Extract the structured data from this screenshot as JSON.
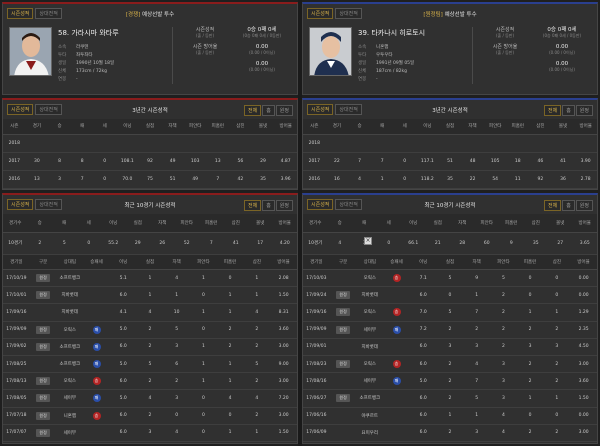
{
  "tabs": {
    "season": "시즌성적",
    "vs": "상대전적"
  },
  "left": {
    "header_team": "[경쟁]",
    "header_title": "예상선발 투수",
    "name": "58. 가라시마 와타루",
    "info": [
      {
        "k": "소속",
        "v": "라쿠텐"
      },
      {
        "k": "투타",
        "v": "좌투좌타"
      },
      {
        "k": "생일",
        "v": "1990년 10월 18일"
      },
      {
        "k": "신체",
        "v": "173cm / 72kg"
      },
      {
        "k": "연봉",
        "v": "-"
      }
    ],
    "stats": [
      {
        "k": "시즌성적",
        "ks": "(출 / 등판)",
        "v": "0승 0패 0세",
        "vs": "(0승 0패 0세 / 0등판)"
      },
      {
        "k": "시즌 방어율",
        "ks": "(출 / 등판)",
        "v": "0.00",
        "vs": "(0.00 / 0이닝)"
      },
      {
        "k": "",
        "ks": "",
        "v": "0.00",
        "vs": "(0.00 / 0이닝)"
      }
    ],
    "three_title": "3년간 시즌성적",
    "three_rows": [
      [
        "2018",
        "",
        "",
        "",
        "",
        "",
        "",
        "",
        "",
        "",
        "",
        "",
        ""
      ],
      [
        "2017",
        "30",
        "8",
        "8",
        "0",
        "108.1",
        "92",
        "49",
        "103",
        "13",
        "56",
        "29",
        "4.87"
      ],
      [
        "2016",
        "13",
        "3",
        "7",
        "0",
        "70.0",
        "75",
        "51",
        "49",
        "7",
        "42",
        "35",
        "3.96"
      ]
    ],
    "recent_title": "최근 10경기 시즌성적",
    "sum_row": [
      "10경기",
      "2",
      "5",
      "0",
      "55.2",
      "29",
      "26",
      "52",
      "7",
      "41",
      "17",
      "4.20"
    ],
    "games": [
      {
        "date": "17/10/19",
        "kind": "원정",
        "opp": "소프트뱅크",
        "res": "",
        "ip": "5.1",
        "r": "1",
        "h": "4",
        "bb": "1",
        "so": "0",
        "er": "1",
        "era": "2.08"
      },
      {
        "date": "17/10/01",
        "kind": "원정",
        "opp": "지바롯데",
        "res": "",
        "ip": "6.0",
        "r": "1",
        "h": "1",
        "bb": "0",
        "so": "1",
        "er": "1",
        "era": "1.50"
      },
      {
        "date": "17/09/16",
        "kind": "",
        "opp": "지바롯데",
        "res": "",
        "ip": "4.1",
        "r": "4",
        "h": "10",
        "bb": "1",
        "so": "1",
        "er": "4",
        "era": "8.31"
      },
      {
        "date": "17/09/09",
        "kind": "원정",
        "opp": "오릭스",
        "res": "loss",
        "ip": "5.0",
        "r": "2",
        "h": "5",
        "bb": "0",
        "so": "2",
        "er": "2",
        "era": "3.60"
      },
      {
        "date": "17/09/02",
        "kind": "원정",
        "opp": "소프트뱅크",
        "res": "loss",
        "ip": "6.0",
        "r": "2",
        "h": "3",
        "bb": "1",
        "so": "2",
        "er": "2",
        "era": "3.00"
      },
      {
        "date": "17/08/25",
        "kind": "",
        "opp": "소프트뱅크",
        "res": "loss",
        "ip": "5.0",
        "r": "5",
        "h": "6",
        "bb": "1",
        "so": "1",
        "er": "5",
        "era": "9.00"
      },
      {
        "date": "17/08/13",
        "kind": "원정",
        "opp": "오릭스",
        "res": "win",
        "ip": "6.0",
        "r": "2",
        "h": "2",
        "bb": "1",
        "so": "1",
        "er": "2",
        "era": "3.00"
      },
      {
        "date": "17/08/05",
        "kind": "원정",
        "opp": "세이부",
        "res": "loss",
        "ip": "5.0",
        "r": "4",
        "h": "3",
        "bb": "0",
        "so": "4",
        "er": "4",
        "era": "7.20"
      },
      {
        "date": "17/07/18",
        "kind": "원정",
        "opp": "니혼햄",
        "res": "win",
        "ip": "6.0",
        "r": "2",
        "h": "0",
        "bb": "0",
        "so": "0",
        "er": "2",
        "era": "3.00"
      },
      {
        "date": "17/07/07",
        "kind": "원정",
        "opp": "세이부",
        "res": "",
        "ip": "6.0",
        "r": "3",
        "h": "4",
        "bb": "0",
        "so": "1",
        "er": "1",
        "era": "1.50"
      }
    ]
  },
  "right": {
    "header_team": "[원정팀]",
    "header_title": "예상선발 투수",
    "name": "39. 타카나시 히로토시",
    "info": [
      {
        "k": "소속",
        "v": "니혼햄"
      },
      {
        "k": "투타",
        "v": "우투우타"
      },
      {
        "k": "생일",
        "v": "1991년 09월 05일"
      },
      {
        "k": "신체",
        "v": "187cm / 82kg"
      },
      {
        "k": "연봉",
        "v": "-"
      }
    ],
    "stats": [
      {
        "k": "시즌성적",
        "ks": "(출 / 등판)",
        "v": "0승 0패 0세",
        "vs": "(0승 0패 0세 / 0등판)"
      },
      {
        "k": "시즌 방어율",
        "ks": "(출 / 등판)",
        "v": "0.00",
        "vs": "(0.00 / 0이닝)"
      },
      {
        "k": "",
        "ks": "",
        "v": "0.00",
        "vs": "(0.00 / 0이닝)"
      }
    ],
    "three_title": "3년간 시즌성적",
    "three_rows": [
      [
        "2018",
        "",
        "",
        "",
        "",
        "",
        "",
        "",
        "",
        "",
        "",
        "",
        ""
      ],
      [
        "2017",
        "22",
        "7",
        "7",
        "0",
        "117.1",
        "51",
        "48",
        "105",
        "18",
        "46",
        "41",
        "3.90"
      ],
      [
        "2016",
        "16",
        "4",
        "1",
        "0",
        "118.2",
        "35",
        "22",
        "54",
        "11",
        "92",
        "36",
        "2.78"
      ]
    ],
    "recent_title": "최근 10경기 시즌성적",
    "sum_row": [
      "10경기",
      "4",
      "3",
      "0",
      "66.1",
      "21",
      "28",
      "60",
      "9",
      "35",
      "27",
      "3.65"
    ],
    "games": [
      {
        "date": "17/10/03",
        "kind": "",
        "opp": "오릭스",
        "res": "win",
        "ip": "7.1",
        "r": "5",
        "h": "9",
        "bb": "5",
        "so": "0",
        "er": "0",
        "era": "0.00"
      },
      {
        "date": "17/09/24",
        "kind": "원정",
        "opp": "지바롯데",
        "res": "",
        "ip": "6.0",
        "r": "0",
        "h": "1",
        "bb": "2",
        "so": "0",
        "er": "0",
        "era": "0.00"
      },
      {
        "date": "17/09/16",
        "kind": "원정",
        "opp": "오릭스",
        "res": "win",
        "ip": "7.0",
        "r": "5",
        "h": "7",
        "bb": "2",
        "so": "1",
        "er": "1",
        "era": "1.29"
      },
      {
        "date": "17/09/09",
        "kind": "원정",
        "opp": "세이부",
        "res": "loss",
        "ip": "7.2",
        "r": "2",
        "h": "2",
        "bb": "2",
        "so": "2",
        "er": "2",
        "era": "2.35"
      },
      {
        "date": "17/09/01",
        "kind": "",
        "opp": "지바롯데",
        "res": "",
        "ip": "6.0",
        "r": "3",
        "h": "3",
        "bb": "2",
        "so": "3",
        "er": "3",
        "era": "4.50"
      },
      {
        "date": "17/08/23",
        "kind": "원정",
        "opp": "오릭스",
        "res": "win",
        "ip": "6.0",
        "r": "2",
        "h": "4",
        "bb": "3",
        "so": "2",
        "er": "2",
        "era": "3.00"
      },
      {
        "date": "17/08/16",
        "kind": "",
        "opp": "세이부",
        "res": "loss",
        "ip": "5.0",
        "r": "2",
        "h": "7",
        "bb": "3",
        "so": "2",
        "er": "2",
        "era": "3.60"
      },
      {
        "date": "17/06/27",
        "kind": "원정",
        "opp": "소프트뱅크",
        "res": "",
        "ip": "6.0",
        "r": "2",
        "h": "5",
        "bb": "3",
        "so": "1",
        "er": "1",
        "era": "1.50"
      },
      {
        "date": "17/06/16",
        "kind": "",
        "opp": "야쿠르트",
        "res": "",
        "ip": "6.0",
        "r": "1",
        "h": "1",
        "bb": "4",
        "so": "0",
        "er": "0",
        "era": "0.00"
      },
      {
        "date": "17/06/09",
        "kind": "",
        "opp": "요미우리",
        "res": "",
        "ip": "6.0",
        "r": "2",
        "h": "3",
        "bb": "4",
        "so": "2",
        "er": "2",
        "era": "3.00"
      }
    ]
  },
  "three_headers": [
    "시즌",
    "경기",
    "승",
    "패",
    "세",
    "이닝",
    "실점",
    "자책",
    "피안타",
    "피홈런",
    "삼진",
    "볼넷",
    "방어율"
  ],
  "sum_headers": [
    "경기수",
    "승",
    "패",
    "세",
    "이닝",
    "실점",
    "자책",
    "피안타",
    "피홈런",
    "삼진",
    "볼넷",
    "방어율"
  ],
  "game_headers": [
    "경기일",
    "구분",
    "상대팀",
    "승패세",
    "이닝",
    "실점",
    "자책",
    "피안타",
    "피홈런",
    "삼진",
    "방어율"
  ],
  "filters": [
    "전체",
    "홈",
    "원정"
  ],
  "res_labels": {
    "win": "승",
    "loss": "패"
  },
  "colors": {
    "accent": "#d9b34a",
    "home_line": "#8a1c1c",
    "away_line": "#2a3f8f",
    "win": "#b32424",
    "loss": "#2a4ea8"
  }
}
